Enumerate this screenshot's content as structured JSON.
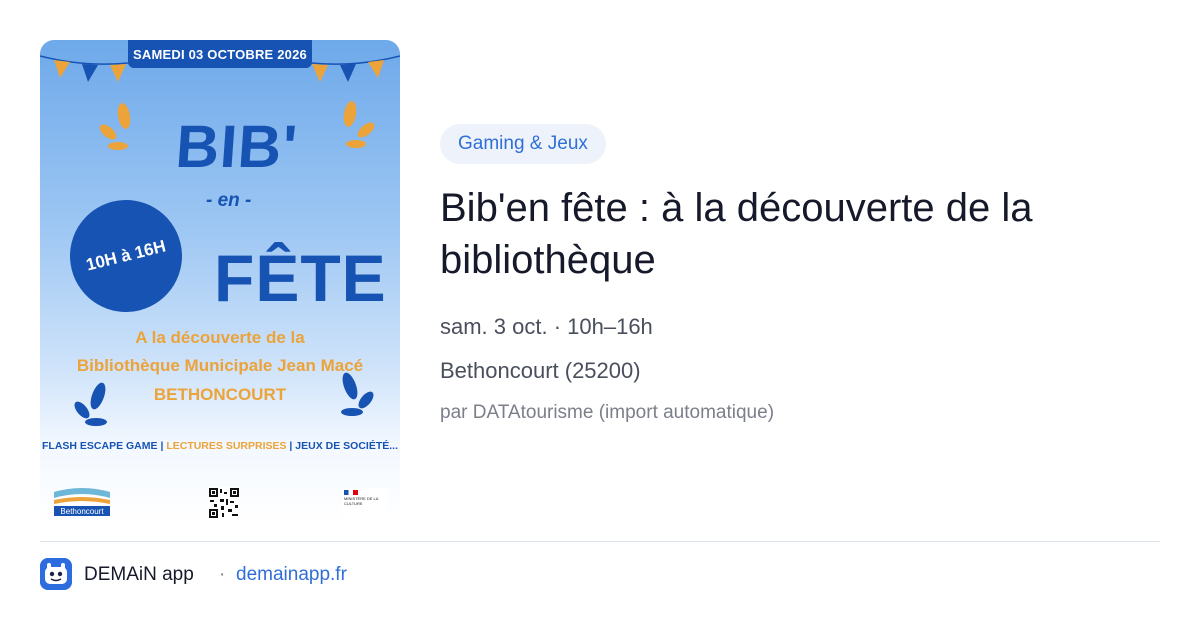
{
  "poster": {
    "date_banner": "SAMEDI 03 OCTOBRE 2026",
    "title_top": "BIB'",
    "title_mid": "- en -",
    "title_bottom": "FÊTE",
    "time_badge": "10H à 16H",
    "subtitle_line1": "A la découverte de la",
    "subtitle_line2": "Bibliothèque Municipale Jean Macé",
    "subtitle_line3": "BETHONCOURT",
    "activity1": "FLASH ESCAPE GAME",
    "activity2": "LECTURES SURPRISES",
    "activity3": "JEUX DE SOCIÉTÉ...",
    "separator": "|",
    "logo_text": "Bethoncourt",
    "culture_text": "MINISTÈRE DE LA CULTURE",
    "colors": {
      "blue": "#1753b3",
      "orange": "#eba33a"
    }
  },
  "event": {
    "category": "Gaming & Jeux",
    "title": "Bib'en fête : à la découverte de la bibliothèque",
    "date": "sam. 3 oct. · 10h–16h",
    "location": "Bethoncourt (25200)",
    "source": "par DATAtourisme (import automatique)"
  },
  "footer": {
    "app_name": "DEMAiN app",
    "dot": "·",
    "link": "demainapp.fr",
    "accent": "#2f6fd6"
  }
}
